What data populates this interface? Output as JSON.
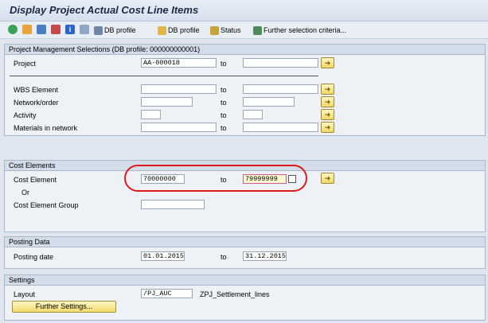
{
  "window": {
    "title": "Display Project Actual Cost Line Items"
  },
  "toolbar": {
    "icons": [
      "execute-icon",
      "get-variant-icon",
      "selection-options-icon",
      "dynamic-selections-icon",
      "info-icon",
      "copy-icon"
    ],
    "db_profile_edit": "DB profile",
    "db_profile": "DB profile",
    "status": "Status",
    "further_selection": "Further selection criteria..."
  },
  "pm_selections": {
    "header": "Project Management Selections (DB profile: 000000000001)",
    "project_label": "Project",
    "project_from": "AA-000018",
    "project_to": "",
    "to_label": "to",
    "wbs_label": "WBS Element",
    "network_label": "Network/order",
    "activity_label": "Activity",
    "materials_label": "Materials in network"
  },
  "cost_elements": {
    "header": "Cost Elements",
    "cost_element_label": "Cost Element",
    "cost_element_from": "70000000",
    "cost_element_to": "79999999",
    "or_label": "Or",
    "group_label": "Cost Element Group",
    "group_value": ""
  },
  "posting_data": {
    "header": "Posting Data",
    "posting_date_label": "Posting date",
    "from": "01.01.2015",
    "to": "31.12.2015"
  },
  "settings": {
    "header": "Settings",
    "layout_label": "Layout",
    "layout_value": "/PJ_AUC",
    "layout_desc": "ZPJ_Settlement_lines",
    "further_settings_button": "Further Settings..."
  },
  "colors": {
    "background": "#dfe6ef",
    "group_header": "#d3dde9",
    "required_field": "#fffbd0",
    "highlight_marker": "#e01818"
  }
}
